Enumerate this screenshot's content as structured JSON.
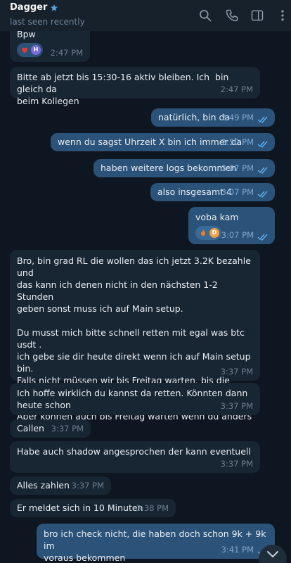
{
  "header": {
    "contact_name": "Dagger",
    "status": "last seen recently",
    "star_icon": "star-icon",
    "actions": [
      "search-icon",
      "phone-icon",
      "sidebar-panel-icon",
      "more-vertical-icon"
    ]
  },
  "colors": {
    "background": "#0e1621",
    "header": "#17212b",
    "incoming_bubble": "#182533",
    "outgoing_bubble": "#2b5278",
    "read_ticks": "#5fb1f5",
    "star": "#4fa3e0"
  },
  "messages": [
    {
      "dir": "in",
      "text": "Bpw",
      "time": "2:47 PM",
      "reactions": [
        {
          "emoji": "❤️",
          "avatar": "H"
        }
      ]
    },
    {
      "dir": "in",
      "text": "Bitte ab jetzt bis 15:30-16 aktiv bleiben. Ich  bin gleich da\nbeim Kollegen",
      "time": "2:47 PM"
    },
    {
      "dir": "out",
      "text": "natürlich, bin da",
      "time": "2:49 PM"
    },
    {
      "dir": "out",
      "text": "wenn du sagst Uhrzeit X bin ich immer da",
      "time": "2:50 PM"
    },
    {
      "dir": "out",
      "text": "haben weitere logs bekommen",
      "time": "3:07 PM"
    },
    {
      "dir": "out",
      "text": "also insgesamt 4",
      "time": "3:07 PM"
    },
    {
      "dir": "out",
      "text": "voba kam",
      "time": "3:07 PM",
      "reactions": [
        {
          "emoji": "🔥",
          "avatar": "D"
        }
      ]
    },
    {
      "dir": "in",
      "text": "Bro, bin grad RL die wollen das ich jetzt 3.2K bezahle und\ndas kann ich denen nicht in den nächsten 1-2 Stunden\ngeben sonst muss ich auf Main setup.\n\nDu musst mich bitte schnell retten mit egal was btc usdt .\nich gebe sie dir heute direkt wenn ich auf Main setup bin.\nFalls nicht müssen wir bis Freitag warten, bis die Kollegen\nback sind :(\nAber können auch bis Freitag warten wenn du anders\nnicht kannst.",
      "time": "3:37 PM"
    },
    {
      "dir": "in",
      "text": "Ich hoffe wirklich du kannst da retten. Könnten dann\nheute schon",
      "time": "3:37 PM"
    },
    {
      "dir": "in",
      "text": "Callen",
      "time": "3:37 PM"
    },
    {
      "dir": "in",
      "text": "Habe auch shadow angesprochen der kann eventuell",
      "time": "3:37 PM"
    },
    {
      "dir": "in",
      "text": "Alles zahlen",
      "time": "3:37 PM"
    },
    {
      "dir": "in",
      "text": "Er meldet sich in 10 Minuten",
      "time": "3:38 PM"
    },
    {
      "dir": "out",
      "text": "bro ich check nicht, die haben doch schon 9k + 9k im\nvoraus bekommen",
      "time": "3:41 PM"
    }
  ]
}
